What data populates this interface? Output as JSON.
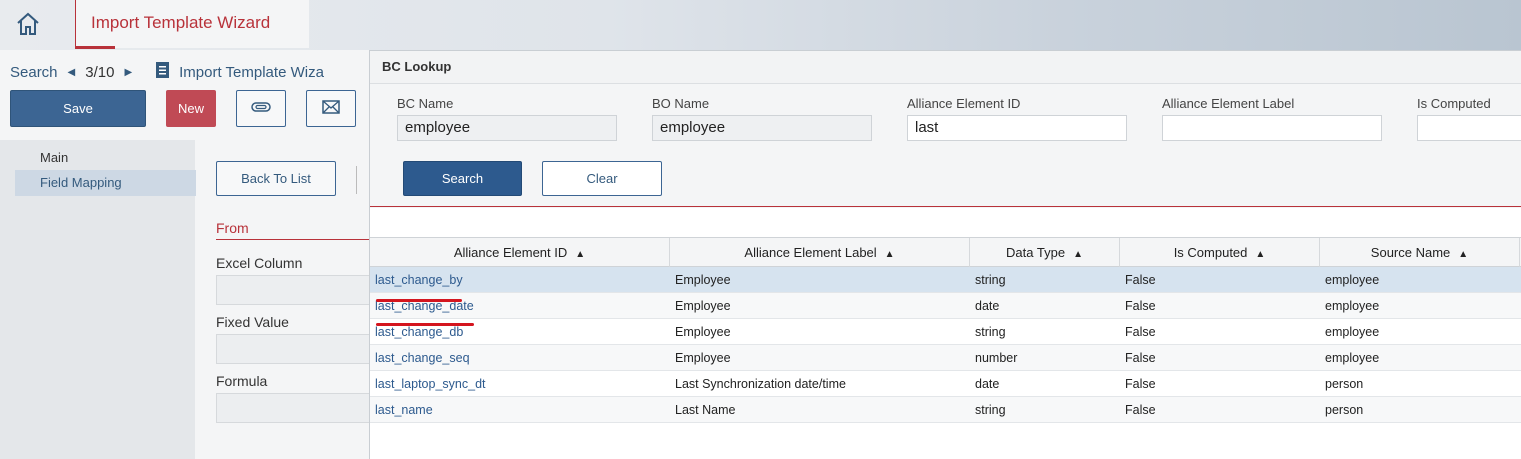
{
  "header": {
    "title": "Import Template Wizard"
  },
  "nav": {
    "search_label": "Search",
    "pager": "3/10",
    "record_title": "Import Template Wiza"
  },
  "toolbar": {
    "save_label": "Save",
    "new_label": "New"
  },
  "sidebar": {
    "items": [
      {
        "label": "Main"
      },
      {
        "label": "Field Mapping"
      }
    ]
  },
  "content": {
    "back_label": "Back To List",
    "from_label": "From",
    "fields": [
      {
        "label": "Excel Column"
      },
      {
        "label": "Fixed Value"
      },
      {
        "label": "Formula"
      }
    ]
  },
  "dialog": {
    "title": "BC Lookup",
    "filters": [
      {
        "label": "BC Name",
        "value": "employee"
      },
      {
        "label": "BO Name",
        "value": "employee"
      },
      {
        "label": "Alliance Element ID",
        "value": "last"
      },
      {
        "label": "Alliance Element Label",
        "value": ""
      },
      {
        "label": "Is Computed",
        "value": ""
      }
    ],
    "search_label": "Search",
    "clear_label": "Clear",
    "columns": [
      {
        "label": "Alliance Element ID",
        "sort": "▲"
      },
      {
        "label": "Alliance Element Label",
        "sort": "▲"
      },
      {
        "label": "Data Type",
        "sort": "▲"
      },
      {
        "label": "Is Computed",
        "sort": "▲"
      },
      {
        "label": "Source Name",
        "sort": "▲"
      }
    ],
    "rows": [
      [
        "last_change_by",
        "Employee",
        "string",
        "False",
        "employee"
      ],
      [
        "last_change_date",
        "Employee",
        "date",
        "False",
        "employee"
      ],
      [
        "last_change_db",
        "Employee",
        "string",
        "False",
        "employee"
      ],
      [
        "last_change_seq",
        "Employee",
        "number",
        "False",
        "employee"
      ],
      [
        "last_laptop_sync_dt",
        "Last Synchronization date/time",
        "date",
        "False",
        "person"
      ],
      [
        "last_name",
        "Last Name",
        "string",
        "False",
        "person"
      ]
    ]
  },
  "colors": {
    "accent_red": "#b8323a",
    "primary_blue": "#2d5a8e",
    "selected_row": "#d6e3ef",
    "annotation_red": "#d4151e"
  }
}
